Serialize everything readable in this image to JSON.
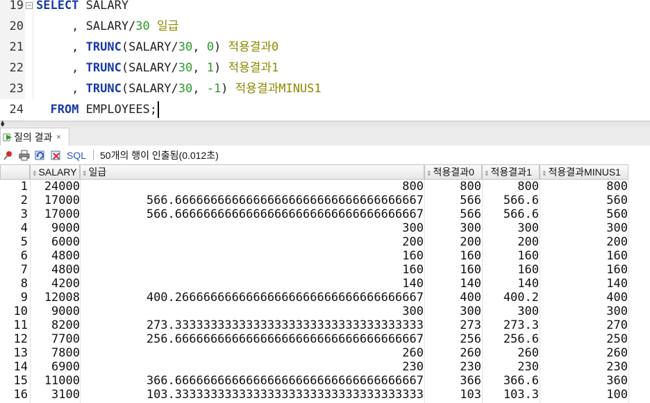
{
  "editor": {
    "lines": [
      {
        "num": "19",
        "parts": [
          {
            "t": "SELECT",
            "c": "kw"
          },
          {
            "t": " SALARY",
            "c": ""
          }
        ]
      },
      {
        "num": "20",
        "parts": [
          {
            "t": "     , SALARY/",
            "c": ""
          },
          {
            "t": "30",
            "c": "num"
          },
          {
            "t": " 일급",
            "c": "alias"
          }
        ]
      },
      {
        "num": "21",
        "parts": [
          {
            "t": "     , ",
            "c": ""
          },
          {
            "t": "TRUNC",
            "c": "kw"
          },
          {
            "t": "(SALARY/",
            "c": ""
          },
          {
            "t": "30",
            "c": "num"
          },
          {
            "t": ", ",
            "c": ""
          },
          {
            "t": "0",
            "c": "num"
          },
          {
            "t": ") ",
            "c": ""
          },
          {
            "t": "적용결과0",
            "c": "alias"
          }
        ]
      },
      {
        "num": "22",
        "parts": [
          {
            "t": "     , ",
            "c": ""
          },
          {
            "t": "TRUNC",
            "c": "kw"
          },
          {
            "t": "(SALARY/",
            "c": ""
          },
          {
            "t": "30",
            "c": "num"
          },
          {
            "t": ", ",
            "c": ""
          },
          {
            "t": "1",
            "c": "num"
          },
          {
            "t": ") ",
            "c": ""
          },
          {
            "t": "적용결과1",
            "c": "alias"
          }
        ]
      },
      {
        "num": "23",
        "parts": [
          {
            "t": "     , ",
            "c": ""
          },
          {
            "t": "TRUNC",
            "c": "kw"
          },
          {
            "t": "(SALARY/",
            "c": ""
          },
          {
            "t": "30",
            "c": "num"
          },
          {
            "t": ", ",
            "c": ""
          },
          {
            "t": "-1",
            "c": "num"
          },
          {
            "t": ") ",
            "c": ""
          },
          {
            "t": "적용결과MINUS1",
            "c": "alias"
          }
        ]
      },
      {
        "num": "24",
        "parts": [
          {
            "t": "  ",
            "c": ""
          },
          {
            "t": "FROM",
            "c": "kw"
          },
          {
            "t": " EMPLOYEES;",
            "c": ""
          }
        ]
      }
    ]
  },
  "results": {
    "tab_label": "질의 결과",
    "tab_close": "×",
    "sql_label": "SQL",
    "status": "50개의 행이 인출됨(0.012초)",
    "columns": [
      "SALARY",
      "일급",
      "적용결과0",
      "적용결과1",
      "적용결과MINUS1"
    ],
    "rows": [
      [
        "1",
        "24000",
        "800",
        "800",
        "800",
        "800"
      ],
      [
        "2",
        "17000",
        "566.66666666666666666666666666666666667",
        "566",
        "566.6",
        "560"
      ],
      [
        "3",
        "17000",
        "566.66666666666666666666666666666666667",
        "566",
        "566.6",
        "560"
      ],
      [
        "4",
        "9000",
        "300",
        "300",
        "300",
        "300"
      ],
      [
        "5",
        "6000",
        "200",
        "200",
        "200",
        "200"
      ],
      [
        "6",
        "4800",
        "160",
        "160",
        "160",
        "160"
      ],
      [
        "7",
        "4800",
        "160",
        "160",
        "160",
        "160"
      ],
      [
        "8",
        "4200",
        "140",
        "140",
        "140",
        "140"
      ],
      [
        "9",
        "12008",
        "400.26666666666666666666666666666666667",
        "400",
        "400.2",
        "400"
      ],
      [
        "10",
        "9000",
        "300",
        "300",
        "300",
        "300"
      ],
      [
        "11",
        "8200",
        "273.33333333333333333333333333333333333",
        "273",
        "273.3",
        "270"
      ],
      [
        "12",
        "7700",
        "256.66666666666666666666666666666666667",
        "256",
        "256.6",
        "250"
      ],
      [
        "13",
        "7800",
        "260",
        "260",
        "260",
        "260"
      ],
      [
        "14",
        "6900",
        "230",
        "230",
        "230",
        "230"
      ],
      [
        "15",
        "11000",
        "366.66666666666666666666666666666666667",
        "366",
        "366.6",
        "360"
      ],
      [
        "16",
        "3100",
        "103.33333333333333333333333333333333333",
        "103",
        "103.3",
        "100"
      ]
    ]
  },
  "icons": {
    "tab": "run-result-icon",
    "toolbar": [
      "pin-icon",
      "print-icon",
      "refresh-icon",
      "export-icon"
    ]
  },
  "colors": {
    "keyword": "#1a3aa6",
    "number": "#2a9a2a",
    "alias": "#8a8a00",
    "sql_link": "#2a55c8"
  }
}
